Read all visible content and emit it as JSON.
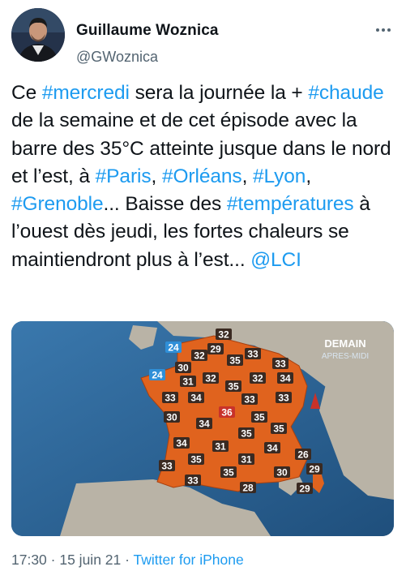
{
  "author": {
    "name": "Guillaume Woznica",
    "handle": "@GWoznica"
  },
  "tweet": {
    "segments": [
      {
        "text": "Ce ",
        "link": false
      },
      {
        "text": "#mercredi",
        "link": true
      },
      {
        "text": " sera la journée la + ",
        "link": false
      },
      {
        "text": "#chaude",
        "link": true
      },
      {
        "text": " de la semaine et de cet épisode avec la barre des 35°C atteinte jusque dans le nord et l’est, à ",
        "link": false
      },
      {
        "text": "#Paris",
        "link": true
      },
      {
        "text": ", ",
        "link": false
      },
      {
        "text": "#Orléans",
        "link": true
      },
      {
        "text": ", ",
        "link": false
      },
      {
        "text": "#Lyon",
        "link": true
      },
      {
        "text": ", ",
        "link": false
      },
      {
        "text": "#Grenoble",
        "link": true
      },
      {
        "text": "... Baisse des ",
        "link": false
      },
      {
        "text": "#températures",
        "link": true
      },
      {
        "text": " à l’ouest dès jeudi, les fortes chaleurs se maintiendront plus à l’est... ",
        "link": false
      },
      {
        "text": "@LCI",
        "link": true
      }
    ]
  },
  "media": {
    "title": "DEMAIN",
    "subtitle": "APRES-MIDI",
    "temperatures": [
      {
        "value": "32",
        "style": "dark"
      },
      {
        "value": "29",
        "style": "dark"
      },
      {
        "value": "24",
        "style": "cool"
      },
      {
        "value": "32",
        "style": "dark"
      },
      {
        "value": "35",
        "style": "dark"
      },
      {
        "value": "33",
        "style": "dark"
      },
      {
        "value": "30",
        "style": "dark"
      },
      {
        "value": "33",
        "style": "dark"
      },
      {
        "value": "24",
        "style": "cool"
      },
      {
        "value": "31",
        "style": "dark"
      },
      {
        "value": "32",
        "style": "dark"
      },
      {
        "value": "35",
        "style": "dark"
      },
      {
        "value": "32",
        "style": "dark"
      },
      {
        "value": "34",
        "style": "dark"
      },
      {
        "value": "33",
        "style": "dark"
      },
      {
        "value": "34",
        "style": "dark"
      },
      {
        "value": "33",
        "style": "dark"
      },
      {
        "value": "33",
        "style": "dark"
      },
      {
        "value": "30",
        "style": "dark"
      },
      {
        "value": "36",
        "style": "hot"
      },
      {
        "value": "35",
        "style": "dark"
      },
      {
        "value": "34",
        "style": "dark"
      },
      {
        "value": "35",
        "style": "dark"
      },
      {
        "value": "35",
        "style": "dark"
      },
      {
        "value": "34",
        "style": "dark"
      },
      {
        "value": "31",
        "style": "dark"
      },
      {
        "value": "34",
        "style": "dark"
      },
      {
        "value": "26",
        "style": "dark"
      },
      {
        "value": "35",
        "style": "dark"
      },
      {
        "value": "31",
        "style": "dark"
      },
      {
        "value": "33",
        "style": "dark"
      },
      {
        "value": "35",
        "style": "dark"
      },
      {
        "value": "30",
        "style": "dark"
      },
      {
        "value": "29",
        "style": "dark"
      },
      {
        "value": "33",
        "style": "dark"
      },
      {
        "value": "28",
        "style": "dark"
      },
      {
        "value": "29",
        "style": "dark"
      }
    ]
  },
  "meta": {
    "time": "17:30",
    "separator": " · ",
    "date": "15 juin 21",
    "client": "Twitter for iPhone"
  },
  "colors": {
    "link": "#1d9bf0",
    "secondary_text": "#536471",
    "sea": "#2c5f8e",
    "land_france": "#e0631e",
    "land_other": "#b9b3a6",
    "badge_dark": "#3a2a22",
    "badge_hot": "#c8322a",
    "badge_cool": "#2f8fd8"
  },
  "icons": {
    "more": "more-dots-icon"
  }
}
